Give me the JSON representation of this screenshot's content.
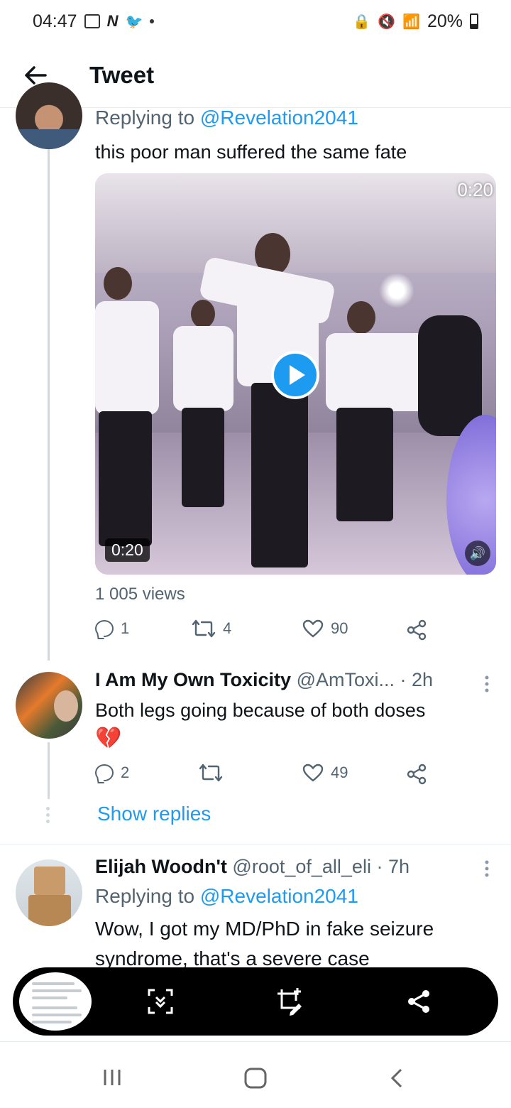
{
  "status_bar": {
    "time": "04:47",
    "battery": "20%"
  },
  "header": {
    "title": "Tweet"
  },
  "tweet1": {
    "replying_label": "Replying to",
    "replying_to": "@Revelation2041",
    "text": "this poor man suffered the same fate",
    "video_duration_top": "0:20",
    "video_duration_bottom": "0:20",
    "views": "1 005 views",
    "reply_count": "1",
    "retweet_count": "4",
    "like_count": "90"
  },
  "tweet2": {
    "name": "I Am My Own Toxicity",
    "handle": "@AmToxi...",
    "time": "· 2h",
    "text": "Both legs going because of both doses",
    "emoji": "💔",
    "reply_count": "2",
    "retweet_count": "",
    "like_count": "49",
    "show_replies": "Show replies"
  },
  "tweet3": {
    "name": "Elijah Woodn't",
    "handle": "@root_of_all_eli",
    "time": "· 7h",
    "replying_label": "Replying to",
    "replying_to": "@Revelation2041",
    "text_line1": "Wow, I got my MD/PhD in fake seizure",
    "text_line2": "syndrome, that's a severe case"
  },
  "icons": {
    "back": "arrow-left-icon",
    "reply": "reply-icon",
    "retweet": "retweet-icon",
    "like": "heart-icon",
    "share": "share-icon",
    "more": "more-vertical-icon"
  },
  "colors": {
    "accent": "#1d9bf0",
    "text_secondary": "#536471"
  }
}
